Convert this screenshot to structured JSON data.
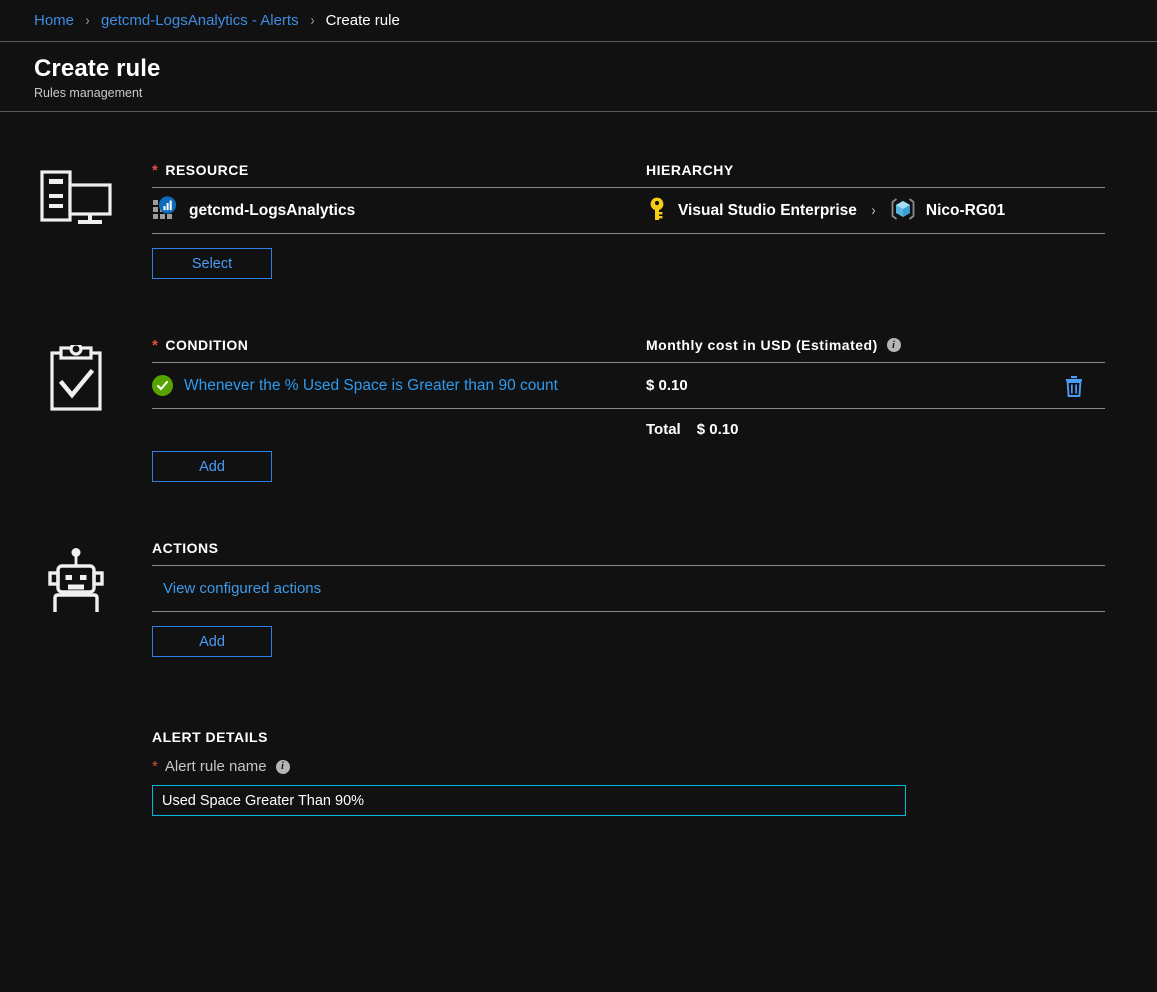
{
  "breadcrumb": {
    "items": [
      {
        "label": "Home",
        "type": "link"
      },
      {
        "label": "getcmd-LogsAnalytics - Alerts",
        "type": "link"
      },
      {
        "label": "Create rule",
        "type": "current"
      }
    ],
    "separator": "›"
  },
  "header": {
    "title": "Create rule",
    "subtitle": "Rules management"
  },
  "resource": {
    "icon": "monitor-icon",
    "heading": "RESOURCE",
    "required_marker": "*",
    "hierarchy_heading": "HIERARCHY",
    "name": "getcmd-LogsAnalytics",
    "name_icon": "log-analytics-icon",
    "hierarchy": {
      "subscription": "Visual Studio Enterprise",
      "subscription_icon": "key-icon",
      "separator": "›",
      "resource_group": "Nico-RG01",
      "resource_group_icon": "resource-group-cube-icon"
    },
    "select_button": "Select"
  },
  "condition": {
    "icon": "clipboard-check-icon",
    "heading": "CONDITION",
    "required_marker": "*",
    "cost_heading": "Monthly cost in USD (Estimated)",
    "cost_info_icon": "info-icon",
    "rows": [
      {
        "status_icon": "green-check-icon",
        "text": "Whenever the % Used Space is Greater than 90 count",
        "cost": "$ 0.10",
        "delete_icon": "trash-icon"
      }
    ],
    "total_label": "Total",
    "total_value": "$ 0.10",
    "add_button": "Add"
  },
  "actions": {
    "icon": "robot-icon",
    "heading": "ACTIONS",
    "view_link": "View configured actions",
    "add_button": "Add"
  },
  "alert_details": {
    "heading": "ALERT DETAILS",
    "required_marker": "*",
    "name_label": "Alert rule name",
    "name_info_icon": "info-icon",
    "name_value": "Used Space Greater Than 90%",
    "name_placeholder": ""
  },
  "colors": {
    "background": "#111111",
    "link": "#3e8ce0",
    "accent_blue": "#2e9bf0",
    "required_red": "#e74c3c",
    "success_green": "#57a300",
    "focus_cyan": "#00b7e3",
    "divider": "#8a8a8a",
    "key_yellow": "#f5cc18",
    "cube_blue": "#50b5e0"
  }
}
